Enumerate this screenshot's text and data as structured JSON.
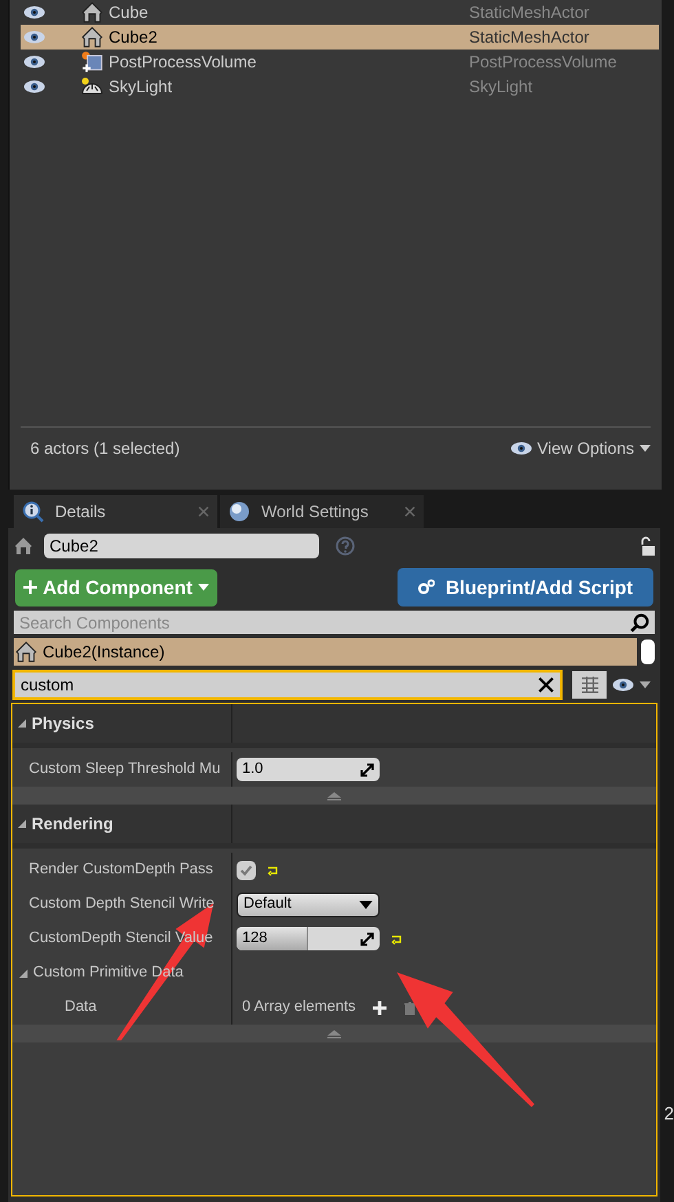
{
  "outliner": {
    "rows": [
      {
        "label": "Cube",
        "type": "StaticMeshActor",
        "kind": "mesh",
        "selected": false
      },
      {
        "label": "Cube2",
        "type": "StaticMeshActor",
        "kind": "mesh",
        "selected": true
      },
      {
        "label": "PostProcessVolume",
        "type": "PostProcessVolume",
        "kind": "volume",
        "selected": false
      },
      {
        "label": "SkyLight",
        "type": "SkyLight",
        "kind": "light",
        "selected": false
      }
    ],
    "status": "6 actors (1 selected)",
    "view_options": "View Options"
  },
  "tabs": [
    {
      "label": "Details",
      "kind": "details",
      "selected": true
    },
    {
      "label": "World Settings",
      "kind": "world",
      "selected": false
    }
  ],
  "details": {
    "name": "Cube2",
    "add_component": "Add Component",
    "blueprint": "Blueprint/Add Script",
    "search_components": {
      "placeholder": "Search Components"
    },
    "component": "Cube2(Instance)",
    "filter": {
      "value": "custom"
    },
    "categories": [
      {
        "title": "Physics",
        "properties": [
          {
            "kind": "number",
            "label": "Custom Sleep Threshold Mu",
            "value": "1.0"
          }
        ]
      },
      {
        "title": "Rendering",
        "properties": [
          {
            "kind": "checkbox",
            "label": "Render CustomDepth Pass",
            "checked": true,
            "reset": true
          },
          {
            "kind": "dropdown",
            "label": "Custom Depth Stencil Write",
            "value": "Default"
          },
          {
            "kind": "slider",
            "label": "CustomDepth Stencil Value",
            "value": "128",
            "level": 0.5,
            "reset": true
          },
          {
            "kind": "group",
            "label": "Custom Primitive Data",
            "expanded": true,
            "children": [
              {
                "kind": "array",
                "label": "Data",
                "value": "0 Array elements"
              }
            ]
          }
        ]
      }
    ]
  },
  "edge_text": "2"
}
